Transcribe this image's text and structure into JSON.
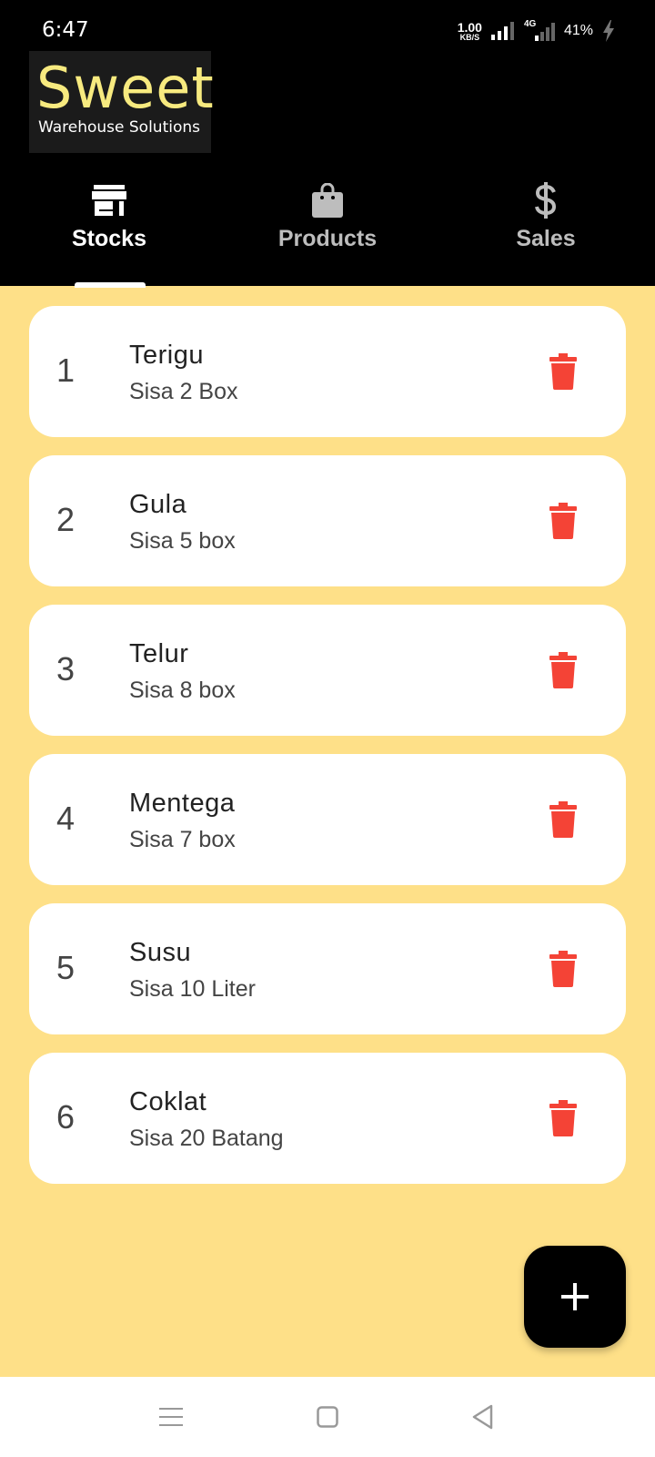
{
  "status_bar": {
    "time": "6:47",
    "net_speed_value": "1.00",
    "net_speed_unit": "KB/S",
    "network_type": "4G",
    "battery": "41%"
  },
  "logo": {
    "title": "Sweet",
    "subtitle": "Warehouse Solutions"
  },
  "tabs": [
    {
      "label": "Stocks",
      "icon": "store-icon",
      "active": true
    },
    {
      "label": "Products",
      "icon": "shopping-bag-icon",
      "active": false
    },
    {
      "label": "Sales",
      "icon": "dollar-icon",
      "active": false
    }
  ],
  "stocks": [
    {
      "number": "1",
      "name": "Terigu",
      "stock": "Sisa 2 Box"
    },
    {
      "number": "2",
      "name": "Gula",
      "stock": "Sisa 5 box"
    },
    {
      "number": "3",
      "name": "Telur",
      "stock": "Sisa 8 box"
    },
    {
      "number": "4",
      "name": "Mentega",
      "stock": "Sisa 7 box"
    },
    {
      "number": "5",
      "name": "Susu",
      "stock": "Sisa 10 Liter"
    },
    {
      "number": "6",
      "name": "Coklat",
      "stock": "Sisa 20 Batang"
    }
  ],
  "colors": {
    "background": "#fee088",
    "header": "#000000",
    "logo_text": "#f7ea7f",
    "delete_icon": "#f44336",
    "fab": "#000000"
  },
  "fab": {
    "icon": "plus-icon"
  },
  "navigation_bar": {
    "icons": [
      "menu-icon",
      "home-square-icon",
      "back-triangle-icon"
    ]
  }
}
